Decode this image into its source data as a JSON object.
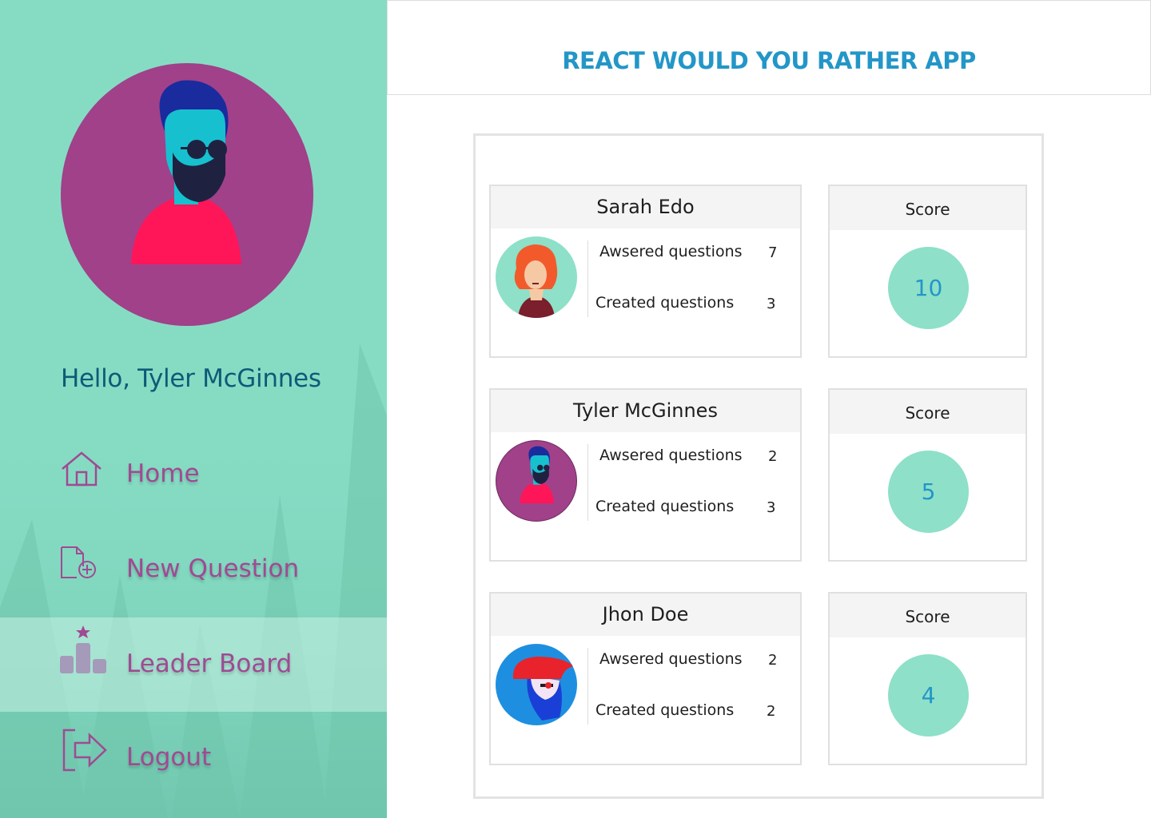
{
  "app_title": "REACT WOULD YOU RATHER APP",
  "greeting": "Hello, Tyler McGinnes",
  "colors": {
    "sidebar_bg": "#86dcc3",
    "accent_purple": "#a04a93",
    "title_blue": "#2396c8",
    "greeting_blue": "#0e5a78",
    "score_circle": "#8ee0c8"
  },
  "nav": {
    "items": [
      {
        "label": "Home",
        "icon": "house-icon",
        "active": false
      },
      {
        "label": "New Question",
        "icon": "new-document-icon",
        "active": false
      },
      {
        "label": "Leader Board",
        "icon": "podium-star-icon",
        "active": true
      },
      {
        "label": "Logout",
        "icon": "logout-arrow-icon",
        "active": false
      }
    ]
  },
  "leaderboard": {
    "score_label": "Score",
    "answered_label": "Awsered questions",
    "created_label": "Created questions",
    "users": [
      {
        "name": "Sarah Edo",
        "answered": "7",
        "created": "3",
        "score": "10",
        "avatar": "red-haired-woman-avatar"
      },
      {
        "name": "Tyler McGinnes",
        "answered": "2",
        "created": "3",
        "score": "5",
        "avatar": "bearded-man-sunglasses-avatar"
      },
      {
        "name": "Jhon Doe",
        "answered": "2",
        "created": "2",
        "score": "4",
        "avatar": "man-red-cap-avatar"
      }
    ]
  }
}
